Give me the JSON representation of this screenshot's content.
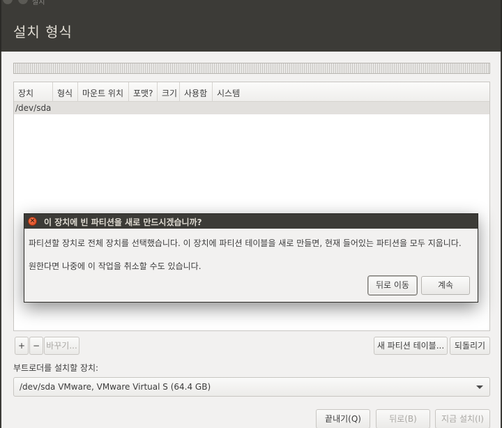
{
  "window": {
    "title_small": "설치",
    "page_title": "설치 형식"
  },
  "table": {
    "columns": [
      "장치",
      "형식",
      "마운트 위치",
      "포맷?",
      "크기",
      "사용함",
      "시스템"
    ],
    "rows": [
      {
        "device": "/dev/sda"
      }
    ]
  },
  "toolbar": {
    "add_label": "+",
    "remove_label": "−",
    "change_label": "바꾸기...",
    "new_table_label": "새 파티션 테이블...",
    "revert_label": "되돌리기"
  },
  "bootloader": {
    "label": "부트로더를 설치할 장치:",
    "selected": "/dev/sda VMware, VMware Virtual S (64.4 GB)"
  },
  "bottom": {
    "quit_label": "끝내기(Q)",
    "back_label": "뒤로(B)",
    "install_label": "지금 설치(I)"
  },
  "dialog": {
    "title": "이 장치에 빈 파티션을 새로 만드시겠습니까?",
    "close_glyph": "×",
    "message1": "파티션할 장치로 전체 장치를 선택했습니다. 이 장치에 파티션 테이블을 새로 만들면, 현재 들어있는 파티션을 모두 지웁니다.",
    "message2": "원한다면 나중에 이 작업을 취소할 수도 있습니다.",
    "back_label": "뒤로 이동",
    "continue_label": "계속"
  },
  "colors": {
    "titlebar": "#3c3b37",
    "window_bg": "#f2f1f0",
    "close_button": "#df4a16"
  }
}
